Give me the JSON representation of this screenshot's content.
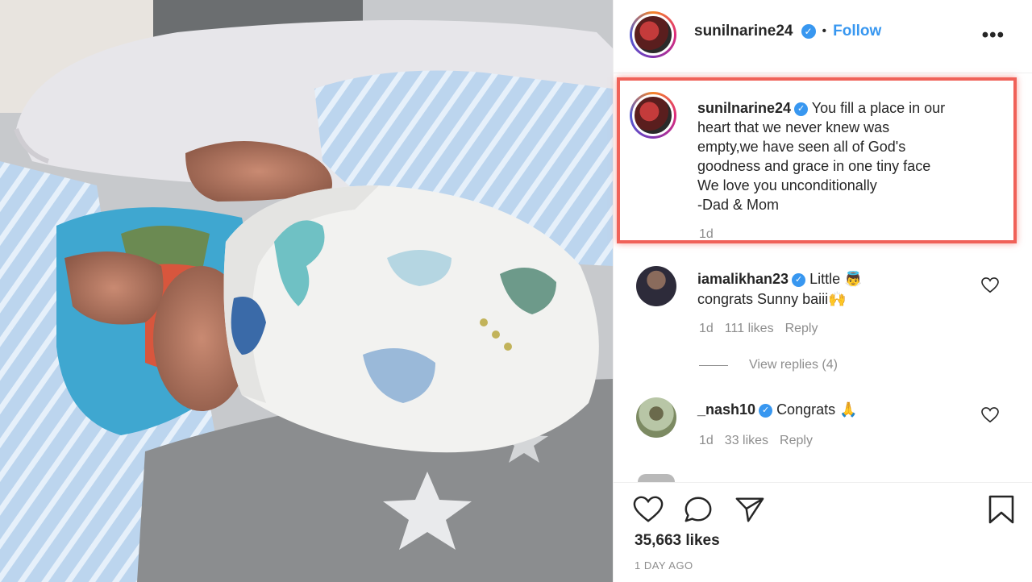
{
  "post": {
    "username": "sunilnarine24",
    "follow_label": "Follow",
    "more_label": "•••",
    "separator": "•"
  },
  "caption": {
    "username": "sunilnarine24",
    "lines": [
      "You fill a place in our",
      "heart that we never knew was",
      "empty,we have seen all of God's",
      "goodness and grace in one tiny face",
      "We love you unconditionally",
      "-Dad & Mom"
    ],
    "time": "1d"
  },
  "comments": [
    {
      "username": "iamalikhan23",
      "text_line1": "Little",
      "emoji1": "👼",
      "text_line2": "congrats Sunny baiii",
      "emoji2": "🙌",
      "time": "1d",
      "likes": "111 likes",
      "reply": "Reply",
      "view_replies": "View replies (4)"
    },
    {
      "username": "_nash10",
      "text": "Congrats",
      "emoji": "🙏",
      "time": "1d",
      "likes": "33 likes",
      "reply": "Reply"
    }
  ],
  "footer": {
    "likes": "35,663 likes",
    "ago": "1 DAY AGO"
  },
  "icons": [
    "heart-icon",
    "comment-icon",
    "share-icon",
    "bookmark-icon",
    "more-icon",
    "verified-icon"
  ],
  "colors": {
    "accent": "#3897f0",
    "highlight_border": "#f06158",
    "muted": "#8e8e8e"
  }
}
